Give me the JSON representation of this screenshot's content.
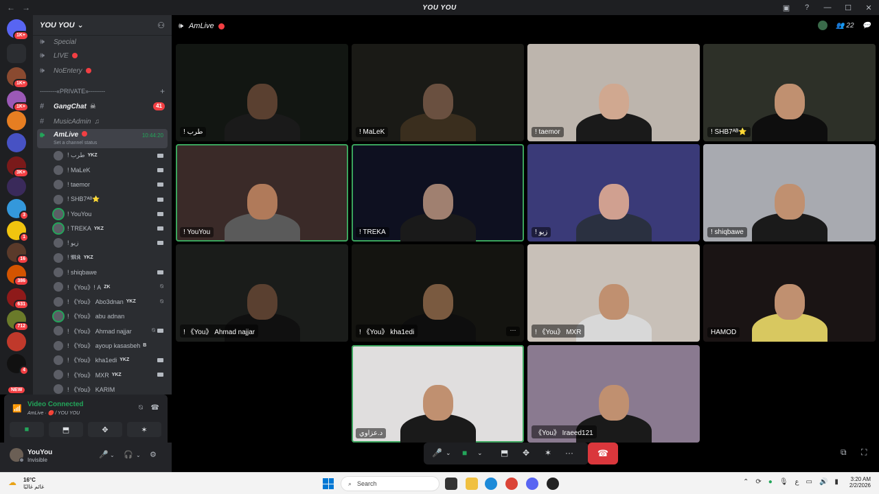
{
  "window": {
    "title": "YOU YOU",
    "nav_back": "←",
    "nav_forward": "→",
    "controls": [
      "—",
      "☐",
      "✕"
    ]
  },
  "colors": {
    "accent_green": "#23a55a",
    "danger_red": "#f23f43",
    "sidebar_bg": "#2b2d31",
    "rail_bg": "#1e1f22"
  },
  "rail": {
    "badges": [
      "1K+",
      "1K+",
      "1K+",
      "3K+",
      "3",
      "1",
      "16",
      "386",
      "631",
      "712",
      "4"
    ],
    "new_label": "NEW"
  },
  "sidebar": {
    "server_name": "YOU YOU",
    "channels_top": [
      {
        "name": "Special",
        "icon": "speaker-icon"
      },
      {
        "name": "LIVE",
        "icon": "speaker-icon"
      },
      {
        "name": "NoEntery",
        "icon": "speaker-icon"
      }
    ],
    "category_label": "--------«PRIVATE»--------",
    "category_plus": "+",
    "channel_gangchat": {
      "name": "GangChat",
      "count": "41"
    },
    "channel_musicadmin": {
      "name": "MusicAdmin"
    },
    "active_channel": {
      "name": "AmLive",
      "time": "10:44:20",
      "status": "Set a channel status"
    },
    "voice_users": [
      {
        "name": "! طرب",
        "tag": "YKZ",
        "cam": true
      },
      {
        "name": "! MaLeK",
        "tag": "",
        "cam": true
      },
      {
        "name": "! taemor",
        "tag": "",
        "cam": true
      },
      {
        "name": "! SHB7ᴬᴮ⭐",
        "tag": "",
        "cam": true
      },
      {
        "name": "! YouYou",
        "tag": "",
        "cam": true,
        "speaking": true
      },
      {
        "name": "! TREKA",
        "tag": "YKZ",
        "cam": true,
        "speaking": true
      },
      {
        "name": "! زيو",
        "tag": "",
        "cam": true
      },
      {
        "name": "! 𝕸𝕶",
        "tag": "YKZ",
        "cam": false
      },
      {
        "name": "! shiqbawe",
        "tag": "",
        "cam": true
      },
      {
        "name": "! 《You》! A",
        "tag": "ZK",
        "cam": false,
        "muted": true
      },
      {
        "name": "! 《You》 Abo3dnan",
        "tag": "YKZ",
        "cam": false,
        "muted": true
      },
      {
        "name": "! 《You》 abu adnan",
        "tag": "",
        "cam": false,
        "speaking": true
      },
      {
        "name": "! 《You》 Ahmad najjar",
        "tag": "",
        "cam": true,
        "muted": true
      },
      {
        "name": "! 《You》 ayoup kasasbeh",
        "tag": "B",
        "cam": false
      },
      {
        "name": "! 《You》 kha1edi",
        "tag": "YKZ",
        "cam": true
      },
      {
        "name": "! 《You》 MXR",
        "tag": "YKZ",
        "cam": true
      },
      {
        "name": "! 《You》 KARIM",
        "tag": "",
        "cam": false
      }
    ]
  },
  "voice_panel": {
    "status": "Video Connected",
    "sub": "AmLive · 🔴 / YOU YOU",
    "buttons": [
      "camera-icon",
      "screenshare-icon",
      "activities-icon",
      "soundboard-icon"
    ]
  },
  "user_panel": {
    "name": "YouYou",
    "status": "Invisible"
  },
  "stage": {
    "channel": "AmLive",
    "participant_count": "22",
    "tiles": [
      {
        "label": "! طرب",
        "speaking": false,
        "bg": "#121612",
        "skin": "#5a4030",
        "shirt": "#1a1a1a"
      },
      {
        "label": "! MaLeK",
        "speaking": false,
        "bg": "#1a1a16",
        "skin": "#6a5040",
        "shirt": "#3a2e1e"
      },
      {
        "label": "! taemor",
        "speaking": false,
        "bg": "#bdb5ad",
        "skin": "#d0a890",
        "shirt": "#1a1a1a"
      },
      {
        "label": "! SHB7ᴬᴮ⭐",
        "speaking": false,
        "bg": "#2d3028",
        "skin": "#c09070",
        "shirt": "#0e0e0e"
      },
      {
        "label": "! YouYou",
        "speaking": true,
        "bg": "#3a2a28",
        "skin": "#b07a5a",
        "shirt": "#5a5a5a"
      },
      {
        "label": "! TREKA",
        "speaking": true,
        "bg": "#0e1020",
        "skin": "#a08070",
        "shirt": "#1a1a1a"
      },
      {
        "label": "! زيو",
        "speaking": false,
        "bg": "#3a3a78",
        "skin": "#d0a090",
        "shirt": "#2a3040"
      },
      {
        "label": "! shiqbawe",
        "speaking": false,
        "bg": "#a8aab0",
        "skin": "#c09070",
        "shirt": "#1a1a1a"
      },
      {
        "label": "! 《You》 Ahmad najjar",
        "speaking": false,
        "bg": "#1a1c1a",
        "skin": "#5a4030",
        "shirt": "#101010",
        "muted": true
      },
      {
        "label": "! 《You》 kha1edi",
        "speaking": false,
        "bg": "#141410",
        "skin": "#7a5a40",
        "shirt": "#0e0e0e",
        "more": true
      },
      {
        "label": "! 《You》 MXR",
        "speaking": false,
        "bg": "#c8c0b8",
        "skin": "#c09070",
        "shirt": "#d8d8d8"
      },
      {
        "label": "HAMOD",
        "speaking": false,
        "bg": "#1a1414",
        "skin": "#c09070",
        "shirt": "#d8c860"
      },
      {
        "label": "د.عزاوي",
        "speaking": true,
        "bg": "#e0dede",
        "skin": "#c09070",
        "shirt": "#1a1a1a"
      },
      {
        "label": "《You》 Iraeed121",
        "speaking": false,
        "bg": "#8a7a90",
        "skin": "#c09070",
        "shirt": "#1a1a1a"
      }
    ],
    "more_label": "···"
  },
  "controls": {
    "mic": "🎤",
    "camera": "📹",
    "share": "⬒",
    "activities": "✥",
    "soundboard": "✶",
    "more": "···",
    "hangup": "☎"
  },
  "taskbar": {
    "temp": "16°C",
    "weather_desc": "غائم غالبًا",
    "search_placeholder": "Search",
    "time": "3:20 AM",
    "date": "2/2/2026",
    "lang": "ع"
  }
}
